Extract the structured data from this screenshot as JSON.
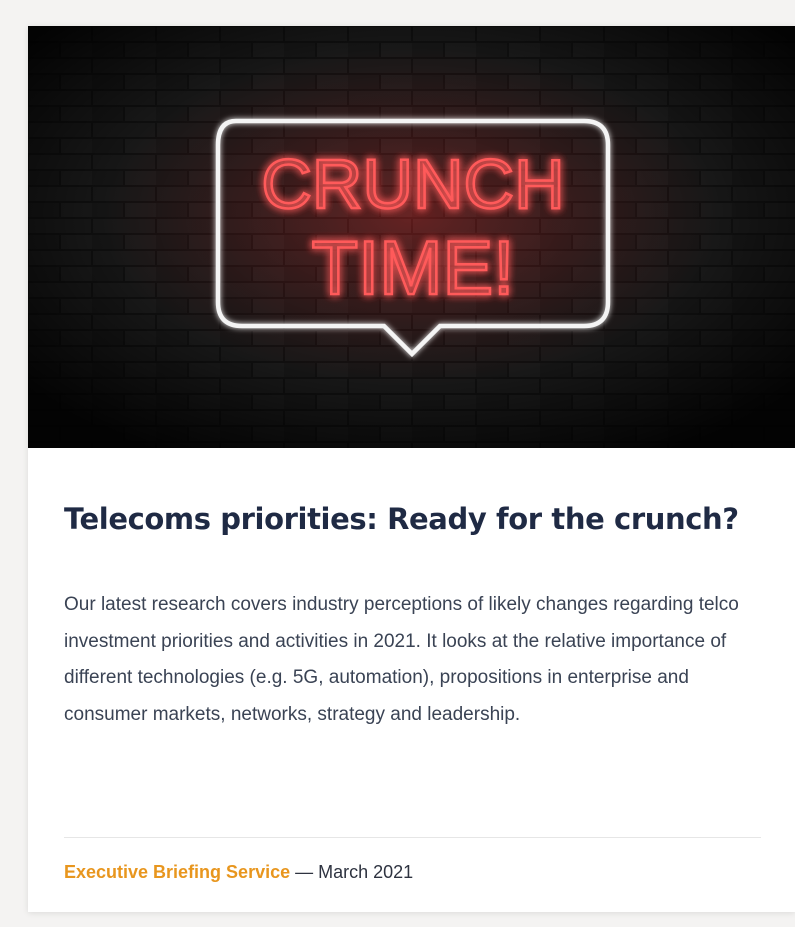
{
  "card": {
    "hero": {
      "sign_line1": "CRUNCH",
      "sign_line2": "TIME!"
    },
    "title": "Telecoms priorities: Ready for the crunch?",
    "description": "Our latest research covers industry perceptions of likely changes regarding telco investment priorities and activities in 2021. It looks at the relative importance of different technologies (e.g. 5G, automation), propositions in enterprise and consumer markets, networks, strategy and leadership.",
    "meta": {
      "service": "Executive Briefing Service",
      "separator": " — ",
      "date": "March 2021"
    }
  },
  "colors": {
    "title": "#1f2a44",
    "accent": "#e8961e",
    "neon_red": "#ff4a4a",
    "background": "#f4f3f2"
  }
}
